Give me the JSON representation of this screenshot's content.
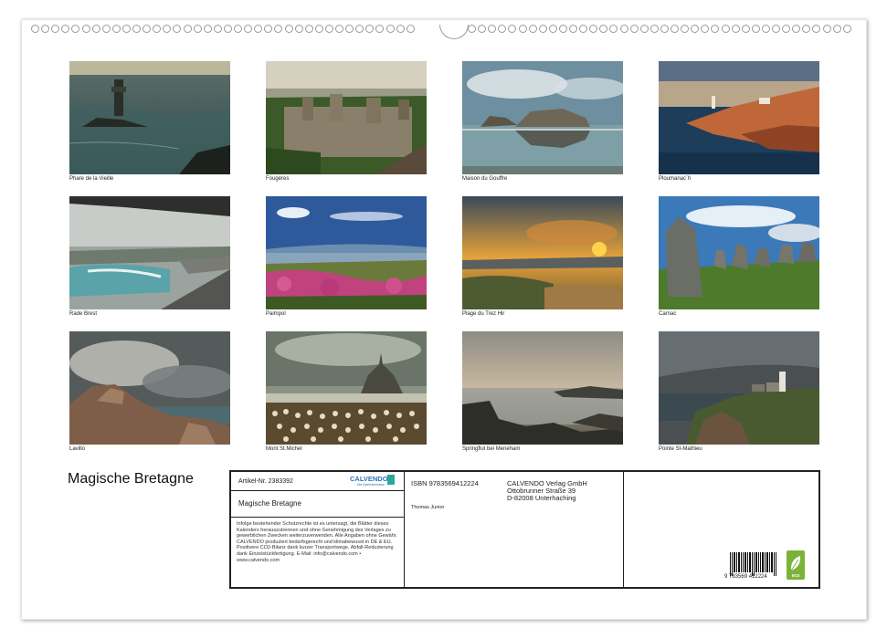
{
  "calendar": {
    "title": "Magische Bretagne",
    "photos": [
      {
        "caption": "Phare de la Vieille"
      },
      {
        "caption": "Fougères"
      },
      {
        "caption": "Maison du Gouffre"
      },
      {
        "caption": "Ploumanac´h"
      },
      {
        "caption": "Rade Brest"
      },
      {
        "caption": "Paimpol"
      },
      {
        "caption": "Plage du Trez Hir"
      },
      {
        "caption": "Carnac"
      },
      {
        "caption": "Lavillo"
      },
      {
        "caption": "Mont St.Michel"
      },
      {
        "caption": "Springflut bei Meneham"
      },
      {
        "caption": "Pointe St-Mathieu"
      }
    ]
  },
  "info": {
    "article": "Artikel-Nr. 2383392",
    "logo": "CALVENDO",
    "logo_sub": "Die Kalendermarke",
    "title": "Magische Bretagne",
    "rights_text": "Infolge bestehender Schutzrechte ist es untersagt, die Blätter dieses Kalenders herauszutrennen und ohne Genehmigung des Verlages zu gewerblichen Zwecken weiterzuverwenden. Alle Angaben ohne Gewähr. CALVENDO produziert bedarfsgerecht und klimabewusst in DE & EU. Positivere CO2-Bilanz dank kurzer Transportwege. Abfall-Reduzierung dank Einzelstückfertigung. E-Mail: info@calvendo.com • www.calvendo.com",
    "isbn": "ISBN 9783569412224",
    "author": "Thomas Junior",
    "publisher_name": "CALVENDO Verlag GmbH",
    "publisher_street": "Ottobrunner Straße 39",
    "publisher_city": "D-82008 Unterhaching",
    "barcode_digits": "9 783569 412224",
    "eco_label": "eco"
  }
}
